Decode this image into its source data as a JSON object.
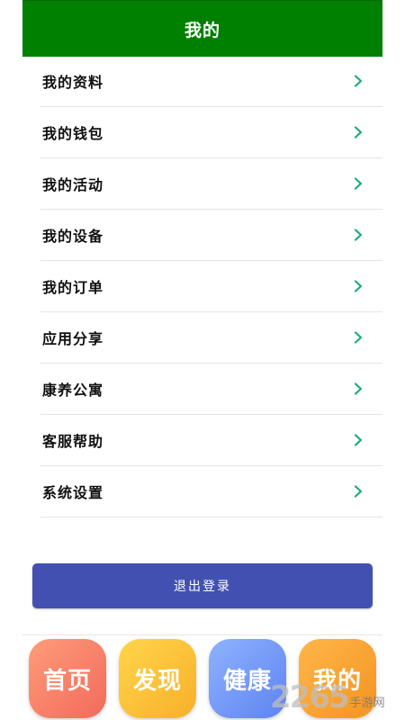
{
  "header": {
    "title": "我的"
  },
  "menu": {
    "items": [
      {
        "label": "我的资料"
      },
      {
        "label": "我的钱包"
      },
      {
        "label": "我的活动"
      },
      {
        "label": "我的设备"
      },
      {
        "label": "我的订单"
      },
      {
        "label": "应用分享"
      },
      {
        "label": "康养公寓"
      },
      {
        "label": "客服帮助"
      },
      {
        "label": "系统设置"
      }
    ]
  },
  "logout": {
    "label": "退出登录"
  },
  "tabbar": {
    "tabs": [
      {
        "label": "首页"
      },
      {
        "label": "发现"
      },
      {
        "label": "健康"
      },
      {
        "label": "我的"
      }
    ]
  },
  "watermark": {
    "number": "2265",
    "suffix": "手游网"
  },
  "colors": {
    "header_bg": "#008000",
    "chevron": "#1aaa7a",
    "logout_bg": "#4251b1",
    "tab_home": "#f47a64",
    "tab_discover": "#f9bf34",
    "tab_health": "#6f93f5",
    "tab_mine": "#f6a030"
  }
}
